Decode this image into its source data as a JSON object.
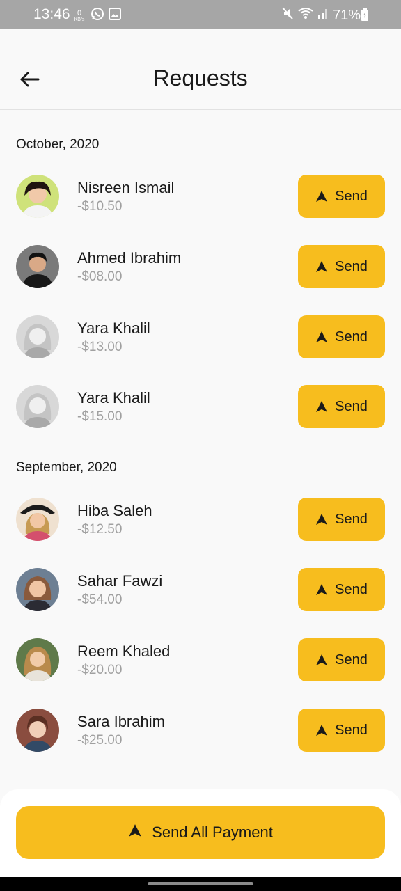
{
  "status_bar": {
    "time": "13:46",
    "data_speed_value": "0",
    "data_speed_unit": "KB/s",
    "battery": "71%",
    "icons": [
      "whatsapp-icon",
      "gallery-icon",
      "mute-icon",
      "wifi-icon",
      "signal-icon",
      "battery-icon"
    ]
  },
  "header": {
    "title": "Requests",
    "back_icon": "arrow-left-icon"
  },
  "sections": [
    {
      "label": "October, 2020",
      "items": [
        {
          "name": "Nisreen Ismail",
          "amount": "-$10.50",
          "button": "Send"
        },
        {
          "name": "Ahmed Ibrahim",
          "amount": "-$08.00",
          "button": "Send"
        },
        {
          "name": "Yara Khalil",
          "amount": "-$13.00",
          "button": "Send"
        },
        {
          "name": "Yara Khalil",
          "amount": "-$15.00",
          "button": "Send"
        }
      ]
    },
    {
      "label": "September, 2020",
      "items": [
        {
          "name": "Hiba Saleh",
          "amount": "-$12.50",
          "button": "Send"
        },
        {
          "name": "Sahar Fawzi",
          "amount": "-$54.00",
          "button": "Send"
        },
        {
          "name": "Reem Khaled",
          "amount": "-$20.00",
          "button": "Send"
        },
        {
          "name": "Sara Ibrahim",
          "amount": "-$25.00",
          "button": "Send"
        }
      ]
    }
  ],
  "footer": {
    "send_all_label": "Send All Payment",
    "icon": "send-icon"
  },
  "colors": {
    "accent": "#f7bd1e",
    "background": "#f9f9f9",
    "text_primary": "#1a1a1a",
    "text_secondary": "#a0a0a0"
  }
}
